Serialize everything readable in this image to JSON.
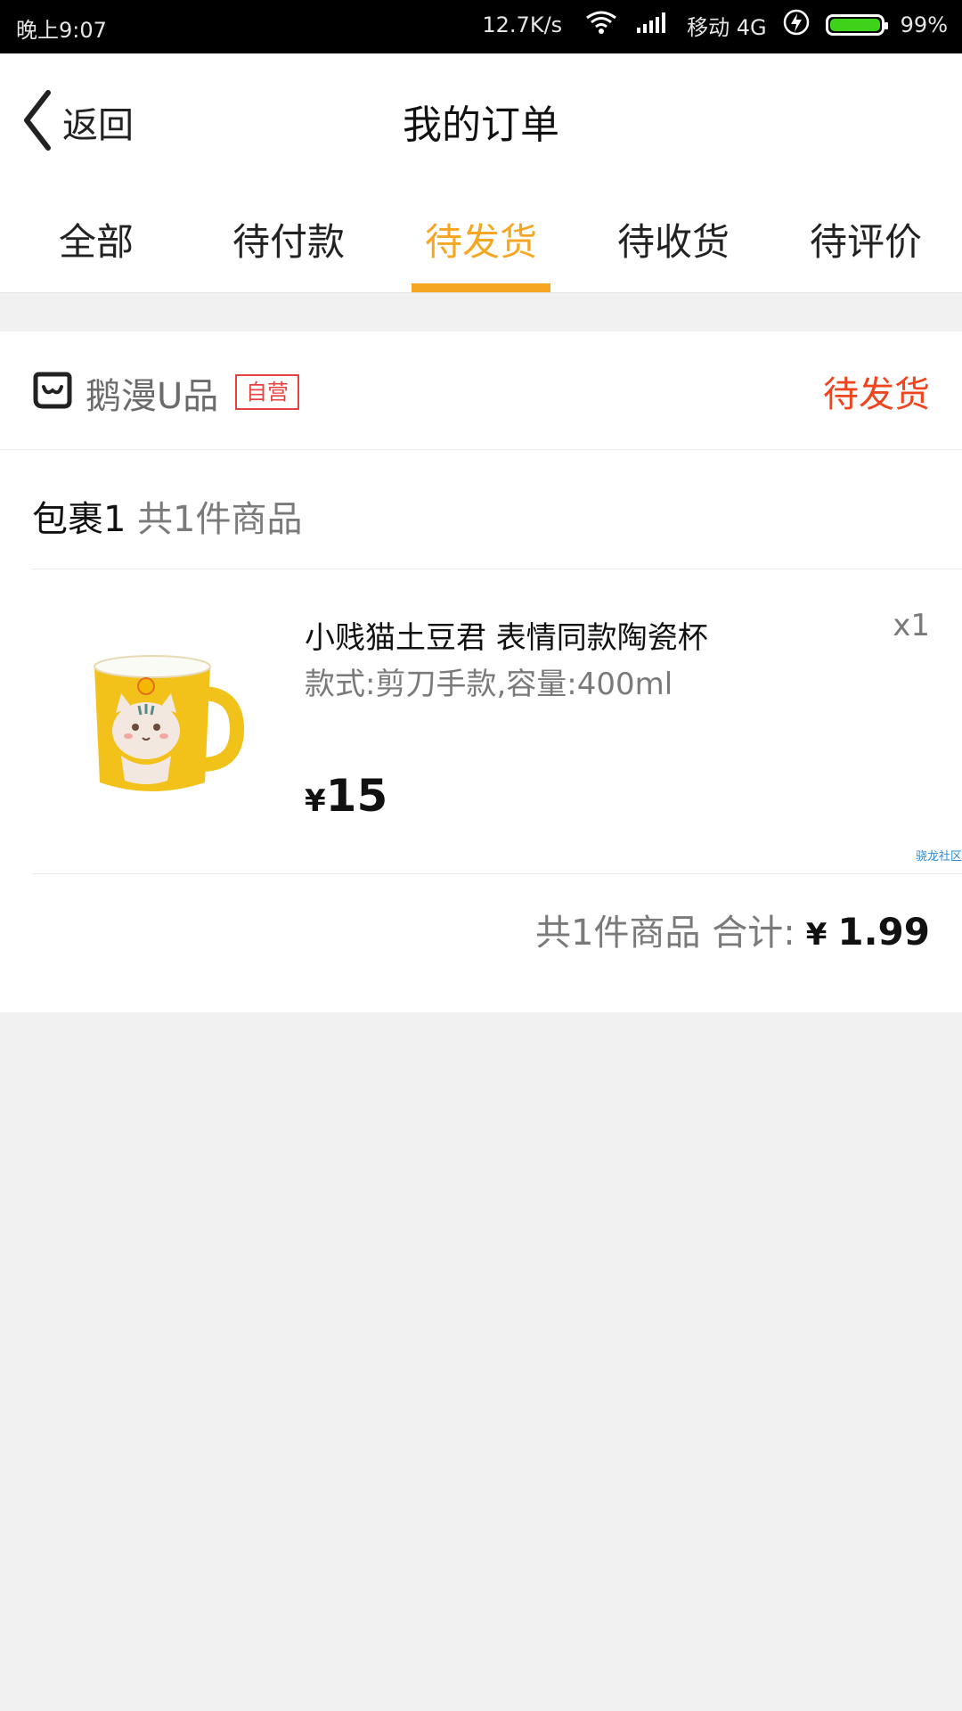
{
  "status_bar": {
    "time": "晚上9:07",
    "speed": "12.7K/s",
    "carrier": "移动 4G",
    "battery": "99%"
  },
  "header": {
    "back_label": "返回",
    "title": "我的订单"
  },
  "tabs": [
    {
      "label": "全部"
    },
    {
      "label": "待付款"
    },
    {
      "label": "待发货",
      "active": true
    },
    {
      "label": "待收货"
    },
    {
      "label": "待评价"
    }
  ],
  "order": {
    "store_name": "鹅漫U品",
    "store_badge": "自营",
    "status": "待发货",
    "package_label": "包裹1",
    "package_count": "共1件商品",
    "item": {
      "title": "小贱猫土豆君 表情同款陶瓷杯",
      "spec": "款式:剪刀手款,容量:400ml",
      "qty": "x1",
      "currency": "¥",
      "price": "15"
    },
    "watermark": "骁龙社区",
    "total_count": "共1件商品 合计:",
    "total_currency": "¥",
    "total_amount": "1.99"
  },
  "colors": {
    "accent": "#f5a623",
    "status": "#f0441e",
    "badge": "#e64340"
  }
}
